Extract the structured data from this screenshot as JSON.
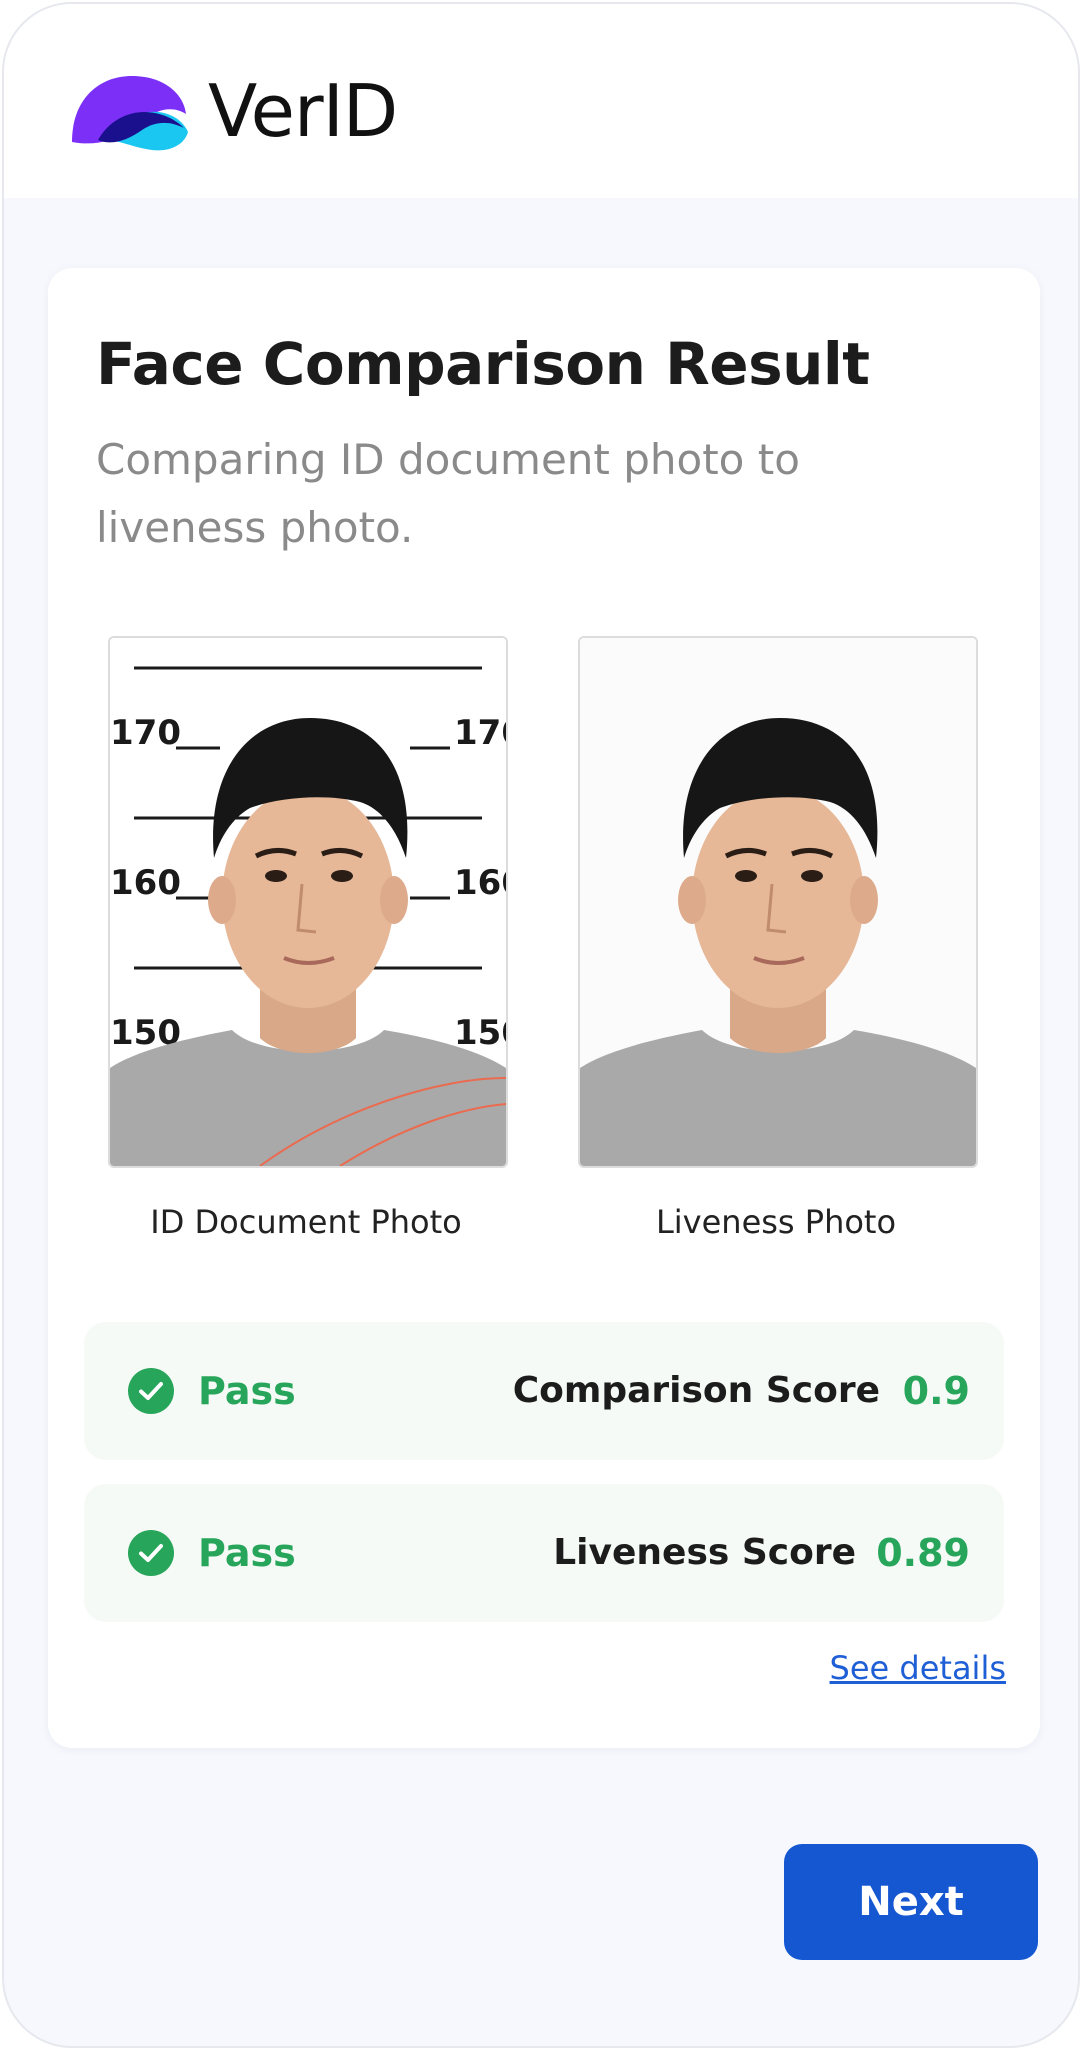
{
  "app": {
    "brand_name": "VerID",
    "logo_icon": "wave-blob-logo",
    "brand_colors": {
      "purple": "#7b2ff7",
      "navy": "#1a0f8c",
      "cyan": "#19c7f0"
    }
  },
  "page": {
    "title": "Face Comparison Result",
    "subtitle": "Comparing ID document photo to liveness photo."
  },
  "photos": [
    {
      "caption": "ID Document Photo",
      "kind": "height-chart-mugshot",
      "height_marks": [
        "170",
        "160",
        "150"
      ]
    },
    {
      "caption": "Liveness Photo",
      "kind": "plain-portrait"
    }
  ],
  "results": [
    {
      "status": "Pass",
      "status_icon": "check-circle-icon",
      "label": "Comparison Score",
      "value": "0.9"
    },
    {
      "status": "Pass",
      "status_icon": "check-circle-icon",
      "label": "Liveness Score",
      "value": "0.89"
    }
  ],
  "links": {
    "see_details": "See details"
  },
  "actions": {
    "next_label": "Next"
  },
  "colors": {
    "pass_green": "#27a55a",
    "primary_blue": "#1556d1",
    "link_blue": "#1f5fd6",
    "background": "#f6f8fd"
  }
}
